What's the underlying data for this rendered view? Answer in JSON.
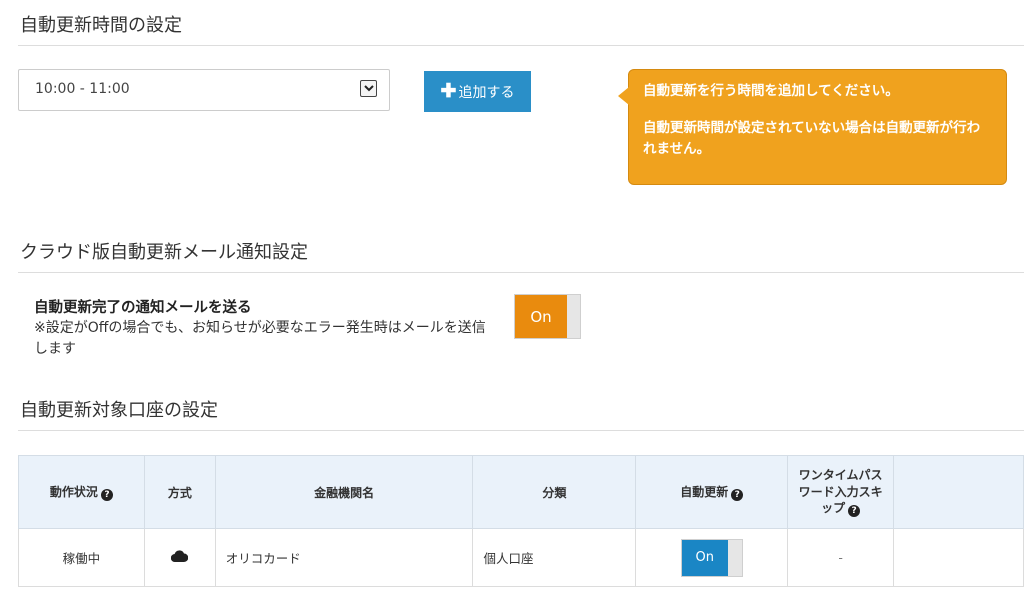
{
  "sections": {
    "update_time_title": "自動更新時間の設定",
    "mail_title": "クラウド版自動更新メール通知設定",
    "accounts_title": "自動更新対象口座の設定"
  },
  "time_setting": {
    "selected": "10:00 - 11:00",
    "add_label": "追加する",
    "tooltip_line1": "自動更新を行う時間を追加してください。",
    "tooltip_line2": "自動更新時間が設定されていない場合は自動更新が行われません。"
  },
  "mail_setting": {
    "label": "自動更新完了の通知メールを送る",
    "note": "※設定がOffの場合でも、お知らせが必要なエラー発生時はメールを送信します",
    "toggle": "On"
  },
  "accounts_table": {
    "headers": {
      "status": "動作状況",
      "method": "方式",
      "institution": "金融機関名",
      "category": "分類",
      "auto_update": "自動更新",
      "otp_skip": "ワンタイムパスワード入力スキップ"
    },
    "rows": [
      {
        "status": "稼働中",
        "method": "cloud-icon",
        "institution": "オリコカード",
        "category": "個人口座",
        "auto_update": "On",
        "otp_skip": "-"
      }
    ]
  },
  "colors": {
    "add_button": "#2a8fc8",
    "tooltip": "#f0a21e",
    "toggle_orange": "#e98b0e",
    "toggle_blue": "#1a86c5",
    "table_header": "#eaf2fa"
  }
}
